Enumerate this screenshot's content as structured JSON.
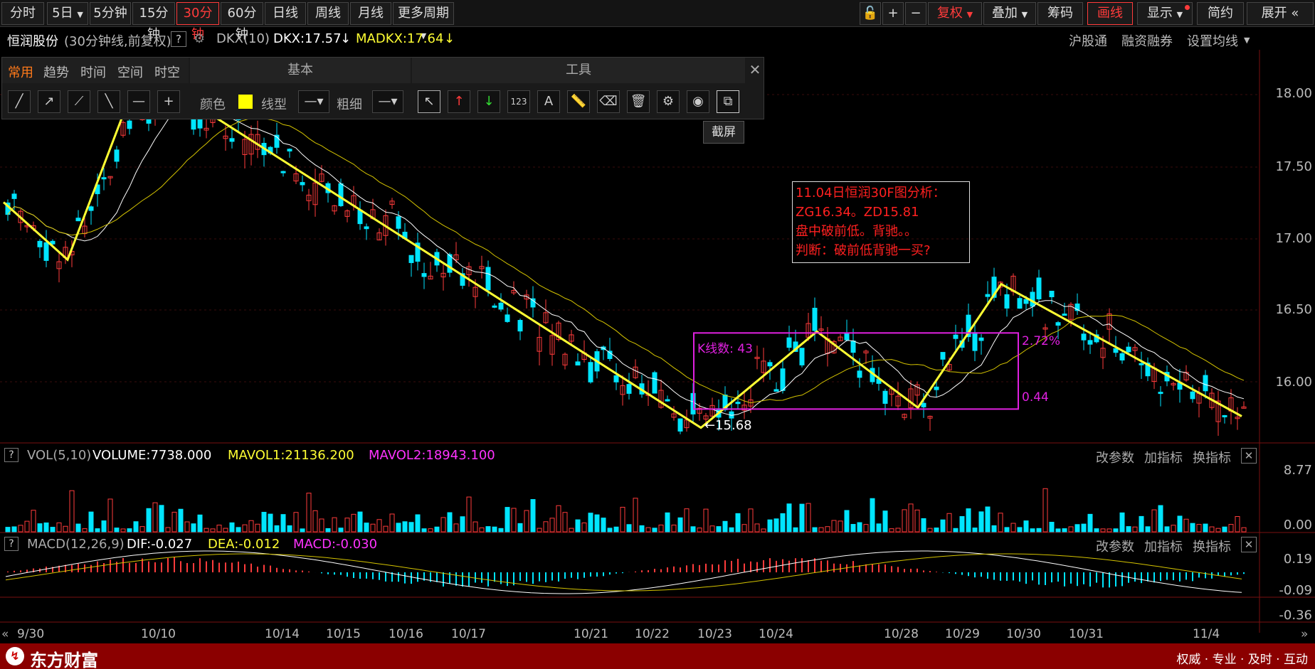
{
  "toolbar": {
    "periods": [
      "分时",
      "5日",
      "5分钟",
      "15分钟",
      "30分钟",
      "60分钟",
      "日线",
      "周线",
      "月线",
      "更多周期"
    ],
    "active_period": "30分钟",
    "right_buttons": [
      "复权",
      "叠加",
      "筹码",
      "画线",
      "显示",
      "简约",
      "展开"
    ],
    "active_right": "画线"
  },
  "info": {
    "stock_name": "恒润股份",
    "period_desc": "(30分钟线,前复权)",
    "help": "?",
    "indicator": "DKX(10)",
    "dkx": "DKX:17.57",
    "madkx": "MADKX:17.64",
    "links": [
      "沪股通",
      "融资融券",
      "设置均线"
    ]
  },
  "draw_panel": {
    "tabs": [
      "常用",
      "趋势",
      "时间",
      "空间",
      "时空"
    ],
    "active_tab": "常用",
    "section_basic": "基本",
    "section_tools": "工具",
    "color_label": "颜色",
    "linetype_label": "线型",
    "thickness_label": "粗细",
    "selected_color": "#ffff00",
    "tooltip": "截屏"
  },
  "annotation": {
    "lines": [
      "11.04日恒润30F图分析：",
      "ZG16.34。ZD15.81",
      "盘中破前低。背驰。。",
      "判断：破前低背驰一买?"
    ],
    "kcount": "K线数: 43",
    "pct": "2.72%",
    "range": "0.44",
    "low_mark": "15.68"
  },
  "price_axis": [
    "18.00",
    "17.50",
    "17.00",
    "16.50",
    "16.00"
  ],
  "vol_panel": {
    "title": "VOL(5,10)",
    "volume": "VOLUME:7738.000",
    "mavol1": "MAVOL1:21136.200",
    "mavol2": "MAVOL2:18943.100",
    "actions": [
      "改参数",
      "加指标",
      "换指标"
    ],
    "axis": [
      "8.77",
      "0.00"
    ]
  },
  "macd_panel": {
    "title": "MACD(12,26,9)",
    "dif": "DIF:-0.027",
    "dea": "DEA:-0.012",
    "macd": "MACD:-0.030",
    "actions": [
      "改参数",
      "加指标",
      "换指标"
    ],
    "axis": [
      "0.19",
      "-0.09",
      "-0.36"
    ]
  },
  "dates": [
    "9/30",
    "10/10",
    "10/14",
    "10/15",
    "10/16",
    "10/17",
    "10/21",
    "10/22",
    "10/23",
    "10/24",
    "10/28",
    "10/29",
    "10/30",
    "10/31",
    "11/4"
  ],
  "status": {
    "brand": "东方财富",
    "slogan": "权威 · 专业 · 及时 · 互动"
  },
  "colors": {
    "up": "#ff3b3b",
    "down": "#00e5ff",
    "accent": "#ff3b3b",
    "trend": "#ffff33",
    "box": "#e020e0"
  }
}
